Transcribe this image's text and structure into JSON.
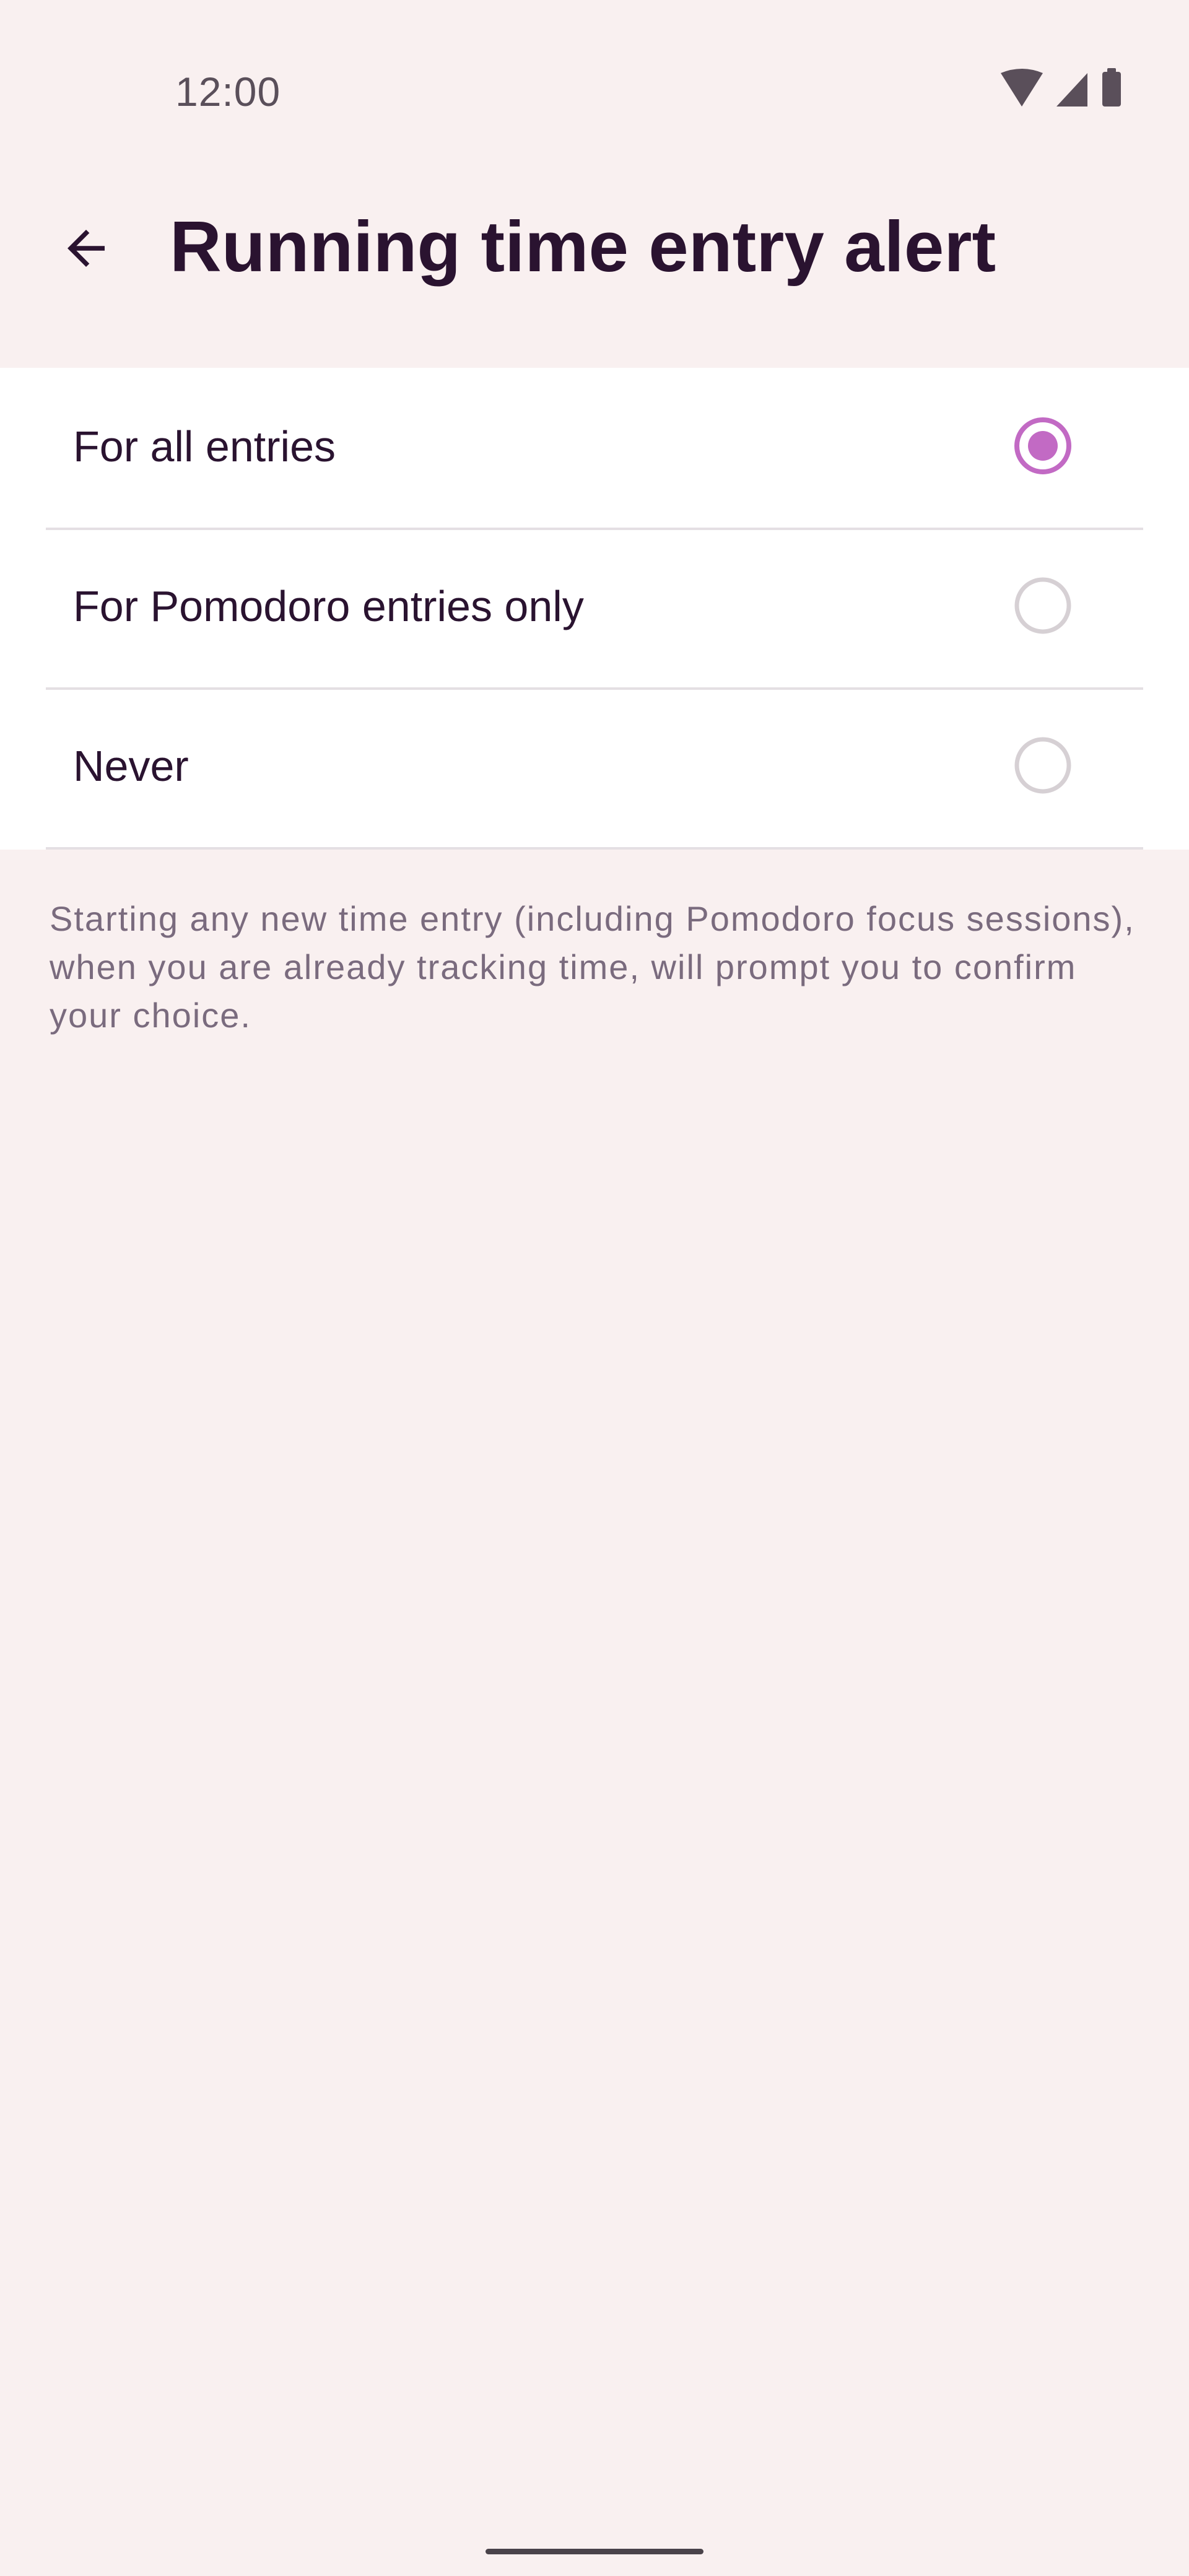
{
  "status_bar": {
    "time": "12:00",
    "icons": [
      "wifi-icon",
      "cellular-signal-icon",
      "battery-icon"
    ]
  },
  "app_bar": {
    "back_icon": "arrow-left-icon",
    "title": "Running time entry alert"
  },
  "options": [
    {
      "label": "For all entries",
      "selected": true
    },
    {
      "label": "For Pomodoro entries only",
      "selected": false
    },
    {
      "label": "Never",
      "selected": false
    }
  ],
  "helper_text": "Starting any new time entry (including Pomodoro focus sessions), when you are already tracking time, will prompt you to confirm your choice.",
  "colors": {
    "background": "#f9f0f0",
    "card": "#ffffff",
    "accent": "#c26ac4",
    "text": "#2a1330",
    "muted_text": "#7a6b7e",
    "divider": "#e4dfe3",
    "radio_unselected": "#d6d0d4"
  }
}
